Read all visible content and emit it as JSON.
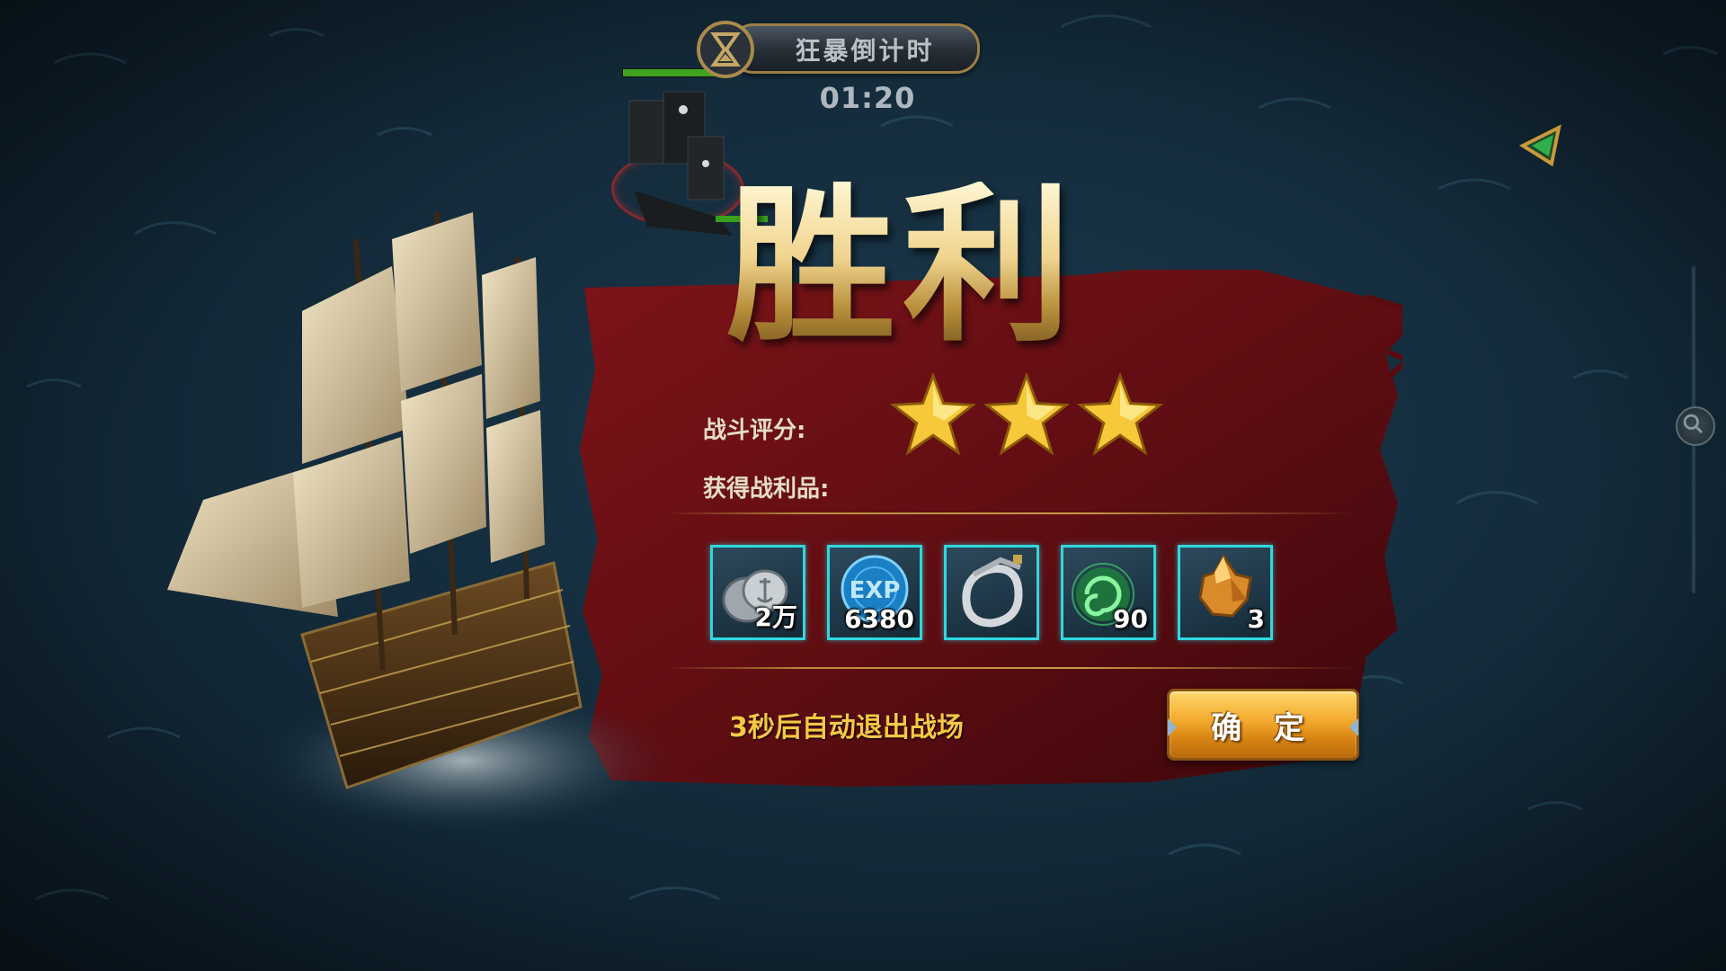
{
  "countdown": {
    "label": "狂暴倒计时",
    "time": "01:20"
  },
  "result": {
    "title": "胜利",
    "rating_label": "战斗评分:",
    "stars": 3,
    "stars_max": 3,
    "loot_label": "获得战利品:"
  },
  "loot": [
    {
      "name": "silver-coins",
      "count": "2万"
    },
    {
      "name": "exp",
      "icon_text": "EXP",
      "count": "6380"
    },
    {
      "name": "silver-ring",
      "count": ""
    },
    {
      "name": "green-orb",
      "count": "90"
    },
    {
      "name": "orange-crystal",
      "count": "3"
    }
  ],
  "footer": {
    "auto_exit": "3秒后自动退出战场",
    "confirm": "确 定"
  },
  "colors": {
    "accent_gold": "#f5c744",
    "panel_red": "#6e0f14",
    "item_border": "#2fd8de",
    "hp_green": "#3fa31f"
  },
  "icons": [
    "hourglass-icon",
    "star-icon",
    "navigation-arrow-icon",
    "zoom-icon"
  ]
}
